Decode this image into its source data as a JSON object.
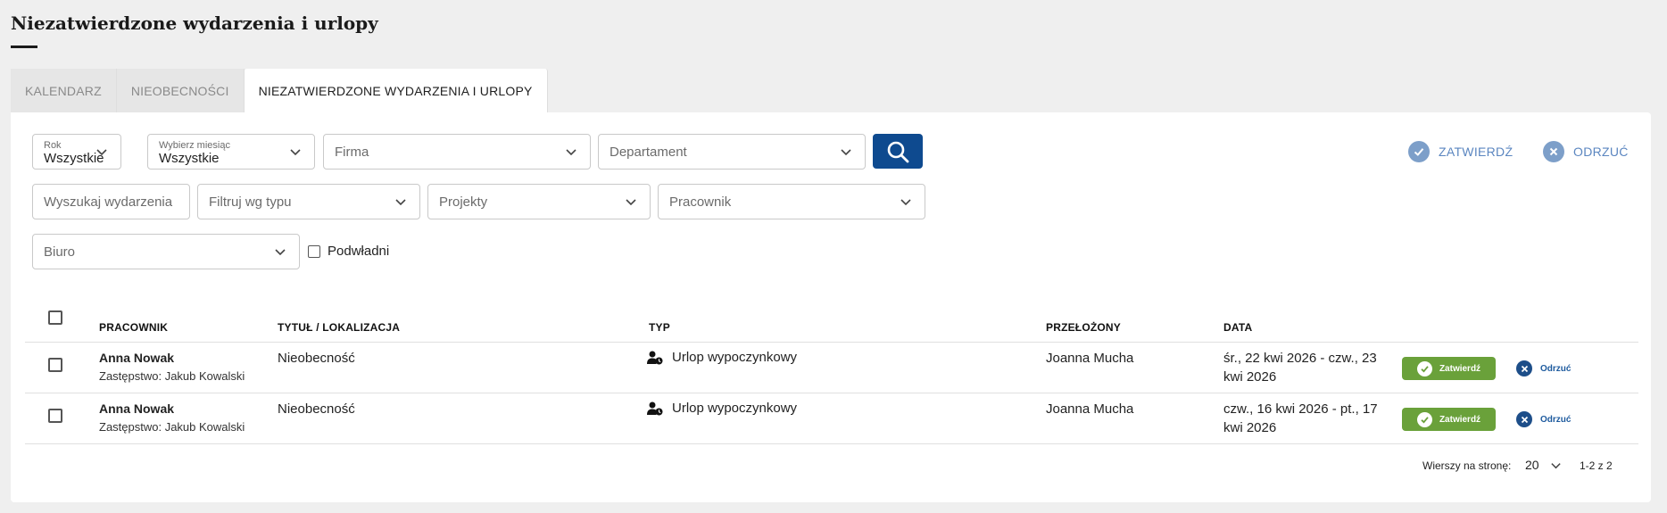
{
  "page": {
    "title": "Niezatwierdzone wydarzenia i urlopy"
  },
  "tabs": [
    {
      "label": "KALENDARZ"
    },
    {
      "label": "NIEOBECNOŚCI"
    },
    {
      "label": "NIEZATWIERDZONE WYDARZENIA I URLOPY"
    }
  ],
  "filters": {
    "year": {
      "label": "Rok",
      "value": "Wszystkie"
    },
    "month": {
      "label": "Wybierz miesiąc",
      "value": "Wszystkie"
    },
    "company": {
      "placeholder": "Firma"
    },
    "department": {
      "placeholder": "Departament"
    },
    "search_events": {
      "placeholder": "Wyszukaj wydarzenia"
    },
    "type": {
      "placeholder": "Filtruj wg typu"
    },
    "projects": {
      "placeholder": "Projekty"
    },
    "employee": {
      "placeholder": "Pracownik"
    },
    "office": {
      "placeholder": "Biuro"
    },
    "subordinates": {
      "label": "Podwładni"
    }
  },
  "actions": {
    "approve_label": "ZATWIERDŹ",
    "reject_label": "ODRZUĆ"
  },
  "table": {
    "columns": [
      "PRACOWNIK",
      "TYTUŁ / LOKALIZACJA",
      "TYP",
      "PRZEŁOŻONY",
      "DATA"
    ],
    "rows": [
      {
        "employee": "Anna Nowak",
        "substitute": "Zastępstwo: Jakub Kowalski",
        "title": "Nieobecność",
        "type": "Urlop wypoczynkowy",
        "supervisor": "Joanna Mucha",
        "date_line1": "śr., 22 kwi 2026 - czw., 23",
        "date_line2": "kwi 2026",
        "approve_label": "Zatwierdź",
        "reject_label": "Odrzuć"
      },
      {
        "employee": "Anna Nowak",
        "substitute": "Zastępstwo: Jakub Kowalski",
        "title": "Nieobecność",
        "type": "Urlop wypoczynkowy",
        "supervisor": "Joanna Mucha",
        "date_line1": "czw., 16 kwi 2026 - pt., 17",
        "date_line2": "kwi 2026",
        "approve_label": "Zatwierdź",
        "reject_label": "Odrzuć"
      }
    ]
  },
  "pagination": {
    "rows_per_page_label": "Wierszy na stronę:",
    "rows_per_page": "20",
    "range": "1-2 z 2"
  },
  "colors": {
    "primary": "#0e4a8f",
    "approve": "#6aa13a",
    "link": "#5b86c0",
    "background": "#efefef"
  },
  "icons": [
    "search-icon",
    "chevron-down-icon",
    "check-circle-icon",
    "close-circle-icon",
    "user-clock-icon"
  ]
}
